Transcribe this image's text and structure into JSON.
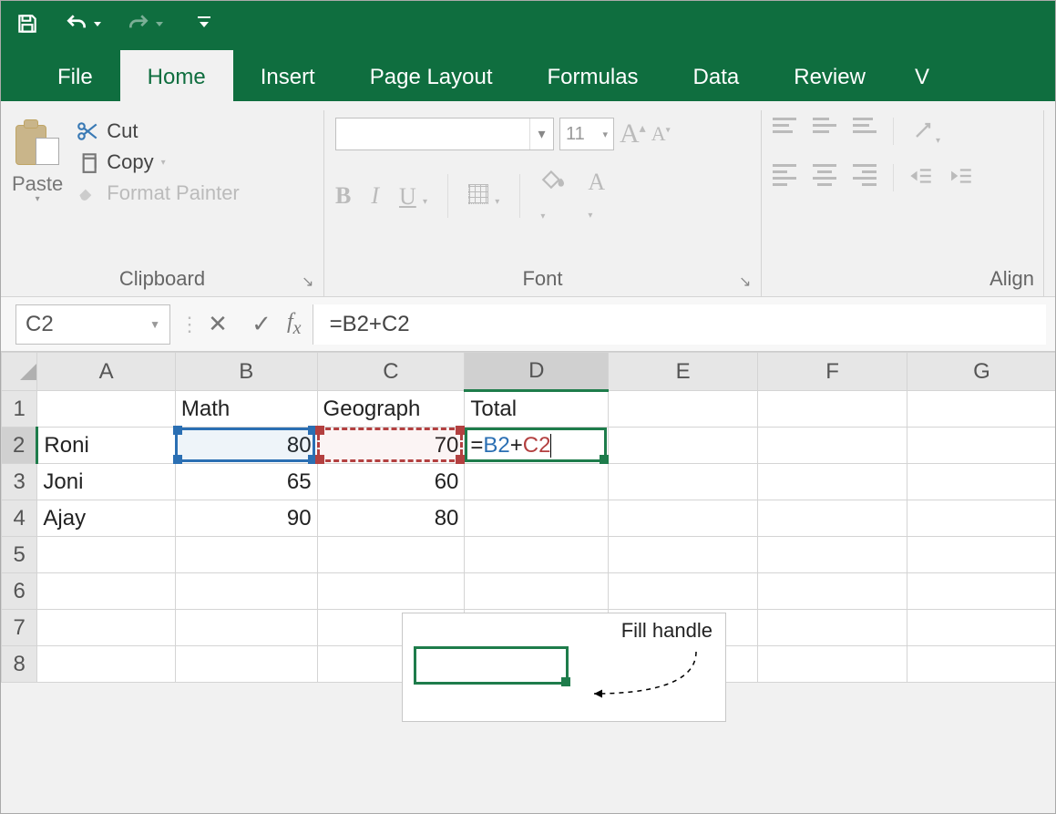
{
  "qat": {
    "save": "Save",
    "undo": "Undo",
    "redo": "Redo",
    "customize": "Customize"
  },
  "tabs": [
    "File",
    "Home",
    "Insert",
    "Page Layout",
    "Formulas",
    "Data",
    "Review",
    "V"
  ],
  "active_tab": "Home",
  "clipboard": {
    "paste": "Paste",
    "cut": "Cut",
    "copy": "Copy",
    "format_painter": "Format Painter",
    "group_label": "Clipboard"
  },
  "font": {
    "name": "",
    "size": "11",
    "bold": "B",
    "italic": "I",
    "underline": "U",
    "group_label": "Font"
  },
  "alignment": {
    "group_label": "Align"
  },
  "namebox": "C2",
  "formula": "=B2+C2",
  "columns": [
    "A",
    "B",
    "C",
    "D",
    "E",
    "F",
    "G"
  ],
  "rows": [
    "1",
    "2",
    "3",
    "4",
    "5",
    "6",
    "7",
    "8"
  ],
  "cells": {
    "B1": "Math",
    "C1": "Geograph",
    "D1": "Total",
    "A2": "Roni",
    "B2": "80",
    "C2": "70",
    "D2_formula": {
      "prefix": "=",
      "r1": "B2",
      "plus": "+",
      "r2": "C2"
    },
    "A3": "Joni",
    "B3": "65",
    "C3": "60",
    "A4": "Ajay",
    "B4": "90",
    "C4": "80"
  },
  "callout": {
    "label": "Fill handle"
  }
}
